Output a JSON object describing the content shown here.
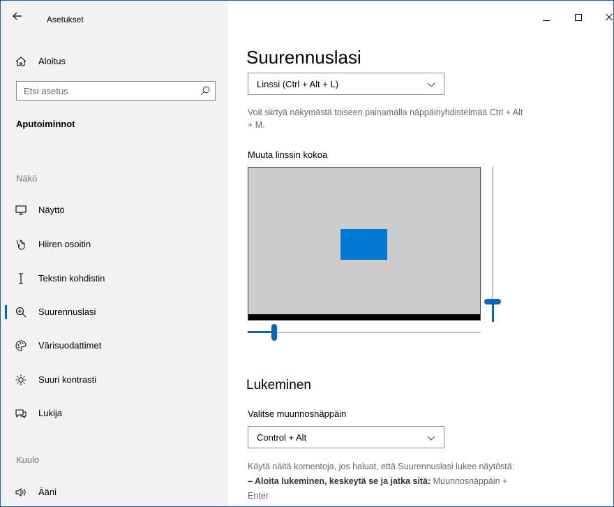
{
  "app": {
    "title": "Asetukset"
  },
  "sidebar": {
    "home_label": "Aloitus",
    "search_placeholder": "Etsi asetus",
    "category": "Aputoiminnot",
    "section_vision": "Näkö",
    "section_hearing": "Kuulo",
    "items": [
      {
        "label": "Näyttö",
        "icon": "monitor-icon"
      },
      {
        "label": "Hiiren osoitin",
        "icon": "mouse-pointer-icon"
      },
      {
        "label": "Tekstin kohdistin",
        "icon": "text-cursor-icon"
      },
      {
        "label": "Suurennuslasi",
        "icon": "magnifier-icon",
        "active": true
      },
      {
        "label": "Värisuodattimet",
        "icon": "palette-icon"
      },
      {
        "label": "Suuri kontrasti",
        "icon": "contrast-icon"
      },
      {
        "label": "Lukija",
        "icon": "narrator-icon"
      },
      {
        "label": "Ääni",
        "icon": "speaker-icon"
      }
    ]
  },
  "main": {
    "title": "Suurennuslasi",
    "view_select": "Linssi (Ctrl + Alt + L)",
    "view_hint_line1": "Voit siirtyä näkymästä toiseen painamalla näppäinyhdistelmää Ctrl + Alt",
    "view_hint_line2": "+ M.",
    "lens_size_label": "Muuta linssin kokoa",
    "reading_heading": "Lukeminen",
    "modifier_label": "Valitse muunnosnäppäin",
    "modifier_select": "Control + Alt",
    "commands_intro": "Käytä näitä komentoja, jos haluat, että Suurennuslasi lukee näytöstä:",
    "commands_item_bold": "– Aloita lukeminen, keskeytä se ja jatka sitä:",
    "commands_item_text": " Muunnosnäppäin +",
    "commands_item_text2": "Enter"
  },
  "colors": {
    "accent": "#0067c0",
    "lens_preview": "#0078d4",
    "sidebar_bg": "#f2f2f2"
  }
}
